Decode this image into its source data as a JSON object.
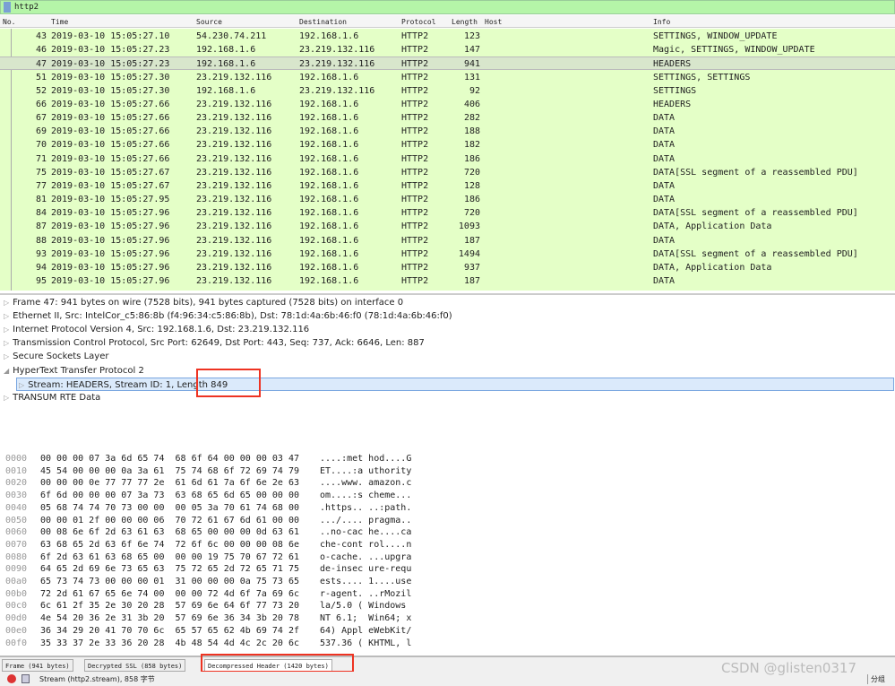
{
  "filter": {
    "value": "http2"
  },
  "columns": [
    "No.",
    "Time",
    "Source",
    "Destination",
    "Protocol",
    "Length",
    "Host",
    "Info"
  ],
  "packets": [
    [
      "43",
      "2019-03-10 15:05:27.10",
      "54.230.74.211",
      "192.168.1.6",
      "HTTP2",
      "123",
      "",
      "SETTINGS, WINDOW_UPDATE"
    ],
    [
      "46",
      "2019-03-10 15:05:27.23",
      "192.168.1.6",
      "23.219.132.116",
      "HTTP2",
      "147",
      "",
      "Magic, SETTINGS, WINDOW_UPDATE"
    ],
    [
      "47",
      "2019-03-10 15:05:27.23",
      "192.168.1.6",
      "23.219.132.116",
      "HTTP2",
      "941",
      "",
      "HEADERS"
    ],
    [
      "51",
      "2019-03-10 15:05:27.30",
      "23.219.132.116",
      "192.168.1.6",
      "HTTP2",
      "131",
      "",
      "SETTINGS, SETTINGS"
    ],
    [
      "52",
      "2019-03-10 15:05:27.30",
      "192.168.1.6",
      "23.219.132.116",
      "HTTP2",
      "92",
      "",
      "SETTINGS"
    ],
    [
      "66",
      "2019-03-10 15:05:27.66",
      "23.219.132.116",
      "192.168.1.6",
      "HTTP2",
      "406",
      "",
      "HEADERS"
    ],
    [
      "67",
      "2019-03-10 15:05:27.66",
      "23.219.132.116",
      "192.168.1.6",
      "HTTP2",
      "282",
      "",
      "DATA"
    ],
    [
      "69",
      "2019-03-10 15:05:27.66",
      "23.219.132.116",
      "192.168.1.6",
      "HTTP2",
      "188",
      "",
      "DATA"
    ],
    [
      "70",
      "2019-03-10 15:05:27.66",
      "23.219.132.116",
      "192.168.1.6",
      "HTTP2",
      "182",
      "",
      "DATA"
    ],
    [
      "71",
      "2019-03-10 15:05:27.66",
      "23.219.132.116",
      "192.168.1.6",
      "HTTP2",
      "186",
      "",
      "DATA"
    ],
    [
      "75",
      "2019-03-10 15:05:27.67",
      "23.219.132.116",
      "192.168.1.6",
      "HTTP2",
      "720",
      "",
      "DATA[SSL segment of a reassembled PDU]"
    ],
    [
      "77",
      "2019-03-10 15:05:27.67",
      "23.219.132.116",
      "192.168.1.6",
      "HTTP2",
      "128",
      "",
      "DATA"
    ],
    [
      "81",
      "2019-03-10 15:05:27.95",
      "23.219.132.116",
      "192.168.1.6",
      "HTTP2",
      "186",
      "",
      "DATA"
    ],
    [
      "84",
      "2019-03-10 15:05:27.96",
      "23.219.132.116",
      "192.168.1.6",
      "HTTP2",
      "720",
      "",
      "DATA[SSL segment of a reassembled PDU]"
    ],
    [
      "87",
      "2019-03-10 15:05:27.96",
      "23.219.132.116",
      "192.168.1.6",
      "HTTP2",
      "1093",
      "",
      "DATA, Application Data"
    ],
    [
      "88",
      "2019-03-10 15:05:27.96",
      "23.219.132.116",
      "192.168.1.6",
      "HTTP2",
      "187",
      "",
      "DATA"
    ],
    [
      "93",
      "2019-03-10 15:05:27.96",
      "23.219.132.116",
      "192.168.1.6",
      "HTTP2",
      "1494",
      "",
      "DATA[SSL segment of a reassembled PDU]"
    ],
    [
      "94",
      "2019-03-10 15:05:27.96",
      "23.219.132.116",
      "192.168.1.6",
      "HTTP2",
      "937",
      "",
      "DATA, Application Data"
    ],
    [
      "95",
      "2019-03-10 15:05:27.96",
      "23.219.132.116",
      "192.168.1.6",
      "HTTP2",
      "187",
      "",
      "DATA"
    ]
  ],
  "selected_packet": "47",
  "details": [
    "Frame 47: 941 bytes on wire (7528 bits), 941 bytes captured (7528 bits) on interface 0",
    "Ethernet II, Src: IntelCor_c5:86:8b (f4:96:34:c5:86:8b), Dst: 78:1d:4a:6b:46:f0 (78:1d:4a:6b:46:f0)",
    "Internet Protocol Version 4, Src: 192.168.1.6, Dst: 23.219.132.116",
    "Transmission Control Protocol, Src Port: 62649, Dst Port: 443, Seq: 737, Ack: 6646, Len: 887",
    "Secure Sockets Layer",
    "HyperText Transfer Protocol 2",
    "Stream: HEADERS, Stream ID: 1, Length 849",
    "TRANSUM RTE Data"
  ],
  "hex": [
    [
      "0000",
      "00 00 00 07 3a 6d 65 74  68 6f 64 00 00 00 03 47",
      "....:met hod....G"
    ],
    [
      "0010",
      "45 54 00 00 00 0a 3a 61  75 74 68 6f 72 69 74 79",
      "ET....:a uthority"
    ],
    [
      "0020",
      "00 00 00 0e 77 77 77 2e  61 6d 61 7a 6f 6e 2e 63",
      "....www. amazon.c"
    ],
    [
      "0030",
      "6f 6d 00 00 00 07 3a 73  63 68 65 6d 65 00 00 00",
      "om....:s cheme..."
    ],
    [
      "0040",
      "05 68 74 74 70 73 00 00  00 05 3a 70 61 74 68 00",
      ".https.. ..:path."
    ],
    [
      "0050",
      "00 00 01 2f 00 00 00 06  70 72 61 67 6d 61 00 00",
      ".../.... pragma.."
    ],
    [
      "0060",
      "00 08 6e 6f 2d 63 61 63  68 65 00 00 00 0d 63 61",
      "..no-cac he....ca"
    ],
    [
      "0070",
      "63 68 65 2d 63 6f 6e 74  72 6f 6c 00 00 00 08 6e",
      "che-cont rol....n"
    ],
    [
      "0080",
      "6f 2d 63 61 63 68 65 00  00 00 19 75 70 67 72 61",
      "o-cache. ...upgra"
    ],
    [
      "0090",
      "64 65 2d 69 6e 73 65 63  75 72 65 2d 72 65 71 75",
      "de-insec ure-requ"
    ],
    [
      "00a0",
      "65 73 74 73 00 00 00 01  31 00 00 00 0a 75 73 65",
      "ests.... 1....use"
    ],
    [
      "00b0",
      "72 2d 61 67 65 6e 74 00  00 00 72 4d 6f 7a 69 6c",
      "r-agent. ..rMozil"
    ],
    [
      "00c0",
      "6c 61 2f 35 2e 30 20 28  57 69 6e 64 6f 77 73 20",
      "la/5.0 ( Windows "
    ],
    [
      "00d0",
      "4e 54 20 36 2e 31 3b 20  57 69 6e 36 34 3b 20 78",
      "NT 6.1;  Win64; x"
    ],
    [
      "00e0",
      "36 34 29 20 41 70 70 6c  65 57 65 62 4b 69 74 2f",
      "64) Appl eWebKit/"
    ],
    [
      "00f0",
      "35 33 37 2e 33 36 20 28  4b 48 54 4d 4c 2c 20 6c",
      "537.36 ( KHTML, l"
    ]
  ],
  "tabs": [
    "Frame (941 bytes)",
    "Decrypted SSL (858 bytes)",
    "Decompressed Header (1420 bytes)"
  ],
  "active_tab": 2,
  "status": {
    "text": "Stream (http2.stream), 858 字节",
    "right": "分组"
  },
  "watermark": "CSDN @glisten0317",
  "colors": {
    "row_bg": "#e4ffc7",
    "filter_bg": "#b5f5a8",
    "highlight_box": "#e32222"
  }
}
